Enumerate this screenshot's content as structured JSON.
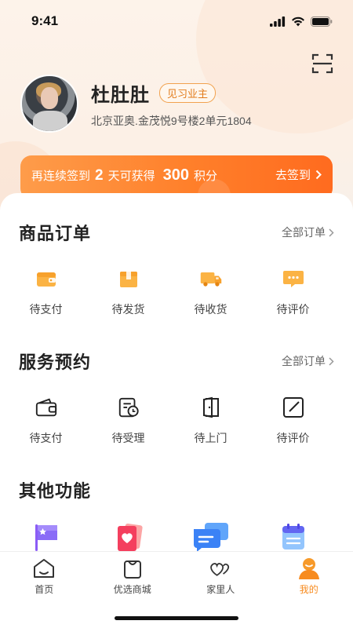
{
  "status_bar": {
    "time": "9:41"
  },
  "profile": {
    "name": "杜肚肚",
    "badge": "见习业主",
    "address": "北京亚奥.金茂悦9号楼2单元1804"
  },
  "signin": {
    "prefix": "再连续签到",
    "days": "2",
    "middle": "天可获得",
    "points": "300",
    "suffix": "积分",
    "action": "去签到"
  },
  "orders": {
    "title": "商品订单",
    "link": "全部订单",
    "items": [
      {
        "label": "待支付",
        "icon": "wallet-icon"
      },
      {
        "label": "待发货",
        "icon": "package-icon"
      },
      {
        "label": "待收货",
        "icon": "truck-icon"
      },
      {
        "label": "待评价",
        "icon": "comment-icon"
      }
    ]
  },
  "services": {
    "title": "服务预约",
    "link": "全部订单",
    "items": [
      {
        "label": "待支付",
        "icon": "wallet-outline-icon"
      },
      {
        "label": "待受理",
        "icon": "document-clock-icon"
      },
      {
        "label": "待上门",
        "icon": "door-icon"
      },
      {
        "label": "待评价",
        "icon": "edit-icon"
      }
    ]
  },
  "other": {
    "title": "其他功能",
    "items": [
      {
        "icon": "flag-icon"
      },
      {
        "icon": "heart-card-icon"
      },
      {
        "icon": "chat-icon"
      },
      {
        "icon": "calendar-icon"
      }
    ]
  },
  "tabbar": {
    "items": [
      {
        "label": "首页",
        "icon": "home-icon",
        "active": false
      },
      {
        "label": "优选商城",
        "icon": "shopping-bag-icon",
        "active": false
      },
      {
        "label": "家里人",
        "icon": "hearts-icon",
        "active": false
      },
      {
        "label": "我的",
        "icon": "profile-icon",
        "active": true
      }
    ]
  },
  "colors": {
    "accent": "#f78b1f",
    "signin_gradient_start": "#fe9c4a",
    "signin_gradient_end": "#ff6b1f"
  }
}
